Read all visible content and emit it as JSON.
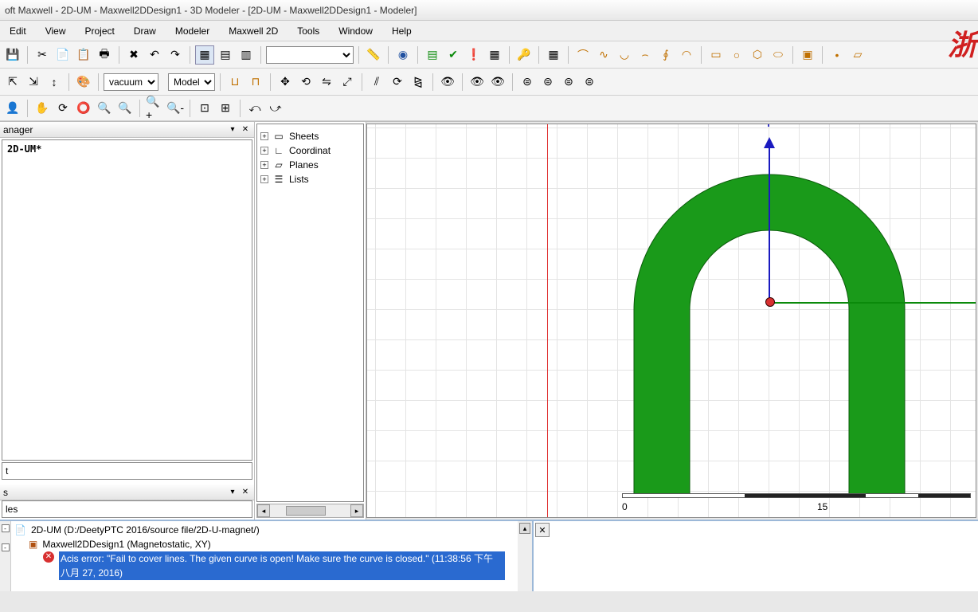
{
  "title": "oft Maxwell - 2D-UM - Maxwell2DDesign1 - 3D Modeler - [2D-UM - Maxwell2DDesign1 - Modeler]",
  "menus": [
    "Edit",
    "View",
    "Project",
    "Draw",
    "Modeler",
    "Maxwell 2D",
    "Tools",
    "Window",
    "Help"
  ],
  "dropdowns": {
    "material": "vacuum",
    "entity": "Model",
    "blank": ""
  },
  "panels": {
    "manager_header": "anager",
    "project_item": "2D-UM*",
    "tabs_item": "t",
    "props_header": "s",
    "props_tab": "les"
  },
  "tree": {
    "items": [
      {
        "label": "Sheets",
        "icon": "sheet"
      },
      {
        "label": "Coordinat",
        "icon": "coord"
      },
      {
        "label": "Planes",
        "icon": "plane"
      },
      {
        "label": "Lists",
        "icon": "list"
      }
    ]
  },
  "axis": {
    "y_label": "Y",
    "ruler_ticks": [
      "0",
      "15"
    ]
  },
  "messages": {
    "line1": "2D-UM (D:/DeetyPTC 2016/source file/2D-U-magnet/)",
    "line2": "Maxwell2DDesign1 (Magnetostatic, XY)",
    "error": "Acis error: \"Fail to cover lines. The given curve is open! Make sure the curve is closed.\" (11:38:56 下午  八月 27, 2016)"
  },
  "watermark": "浙"
}
